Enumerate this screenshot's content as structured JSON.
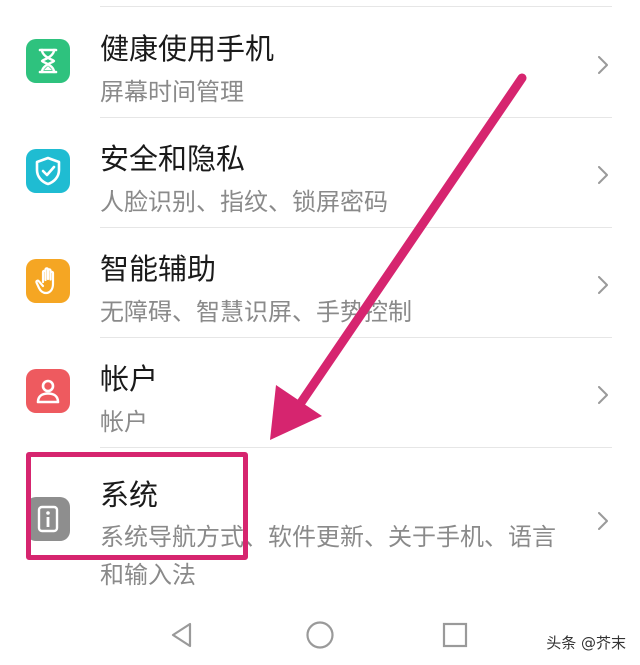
{
  "settings": {
    "items": [
      {
        "title": "健康使用手机",
        "subtitle": "屏幕时间管理",
        "icon": "hourglass-icon",
        "color": "#2ec27e"
      },
      {
        "title": "安全和隐私",
        "subtitle": "人脸识别、指纹、锁屏密码",
        "icon": "shield-check-icon",
        "color": "#1fbcd2"
      },
      {
        "title": "智能辅助",
        "subtitle": "无障碍、智慧识屏、手势控制",
        "icon": "hand-icon",
        "color": "#f5a623"
      },
      {
        "title": "帐户",
        "subtitle": "帐户",
        "icon": "account-icon",
        "color": "#ee5a5f"
      },
      {
        "title": "系统",
        "subtitle": "系统导航方式、软件更新、关于手机、语言和输入法",
        "icon": "system-info-icon",
        "color": "#8e8e8e"
      }
    ]
  },
  "annotation": {
    "color": "#d6256f"
  },
  "nav_bar": {
    "back_icon": "back-triangle-icon",
    "home_icon": "home-circle-icon",
    "recent_icon": "recent-square-icon"
  },
  "watermark": {
    "text": "头条 @芥末"
  }
}
